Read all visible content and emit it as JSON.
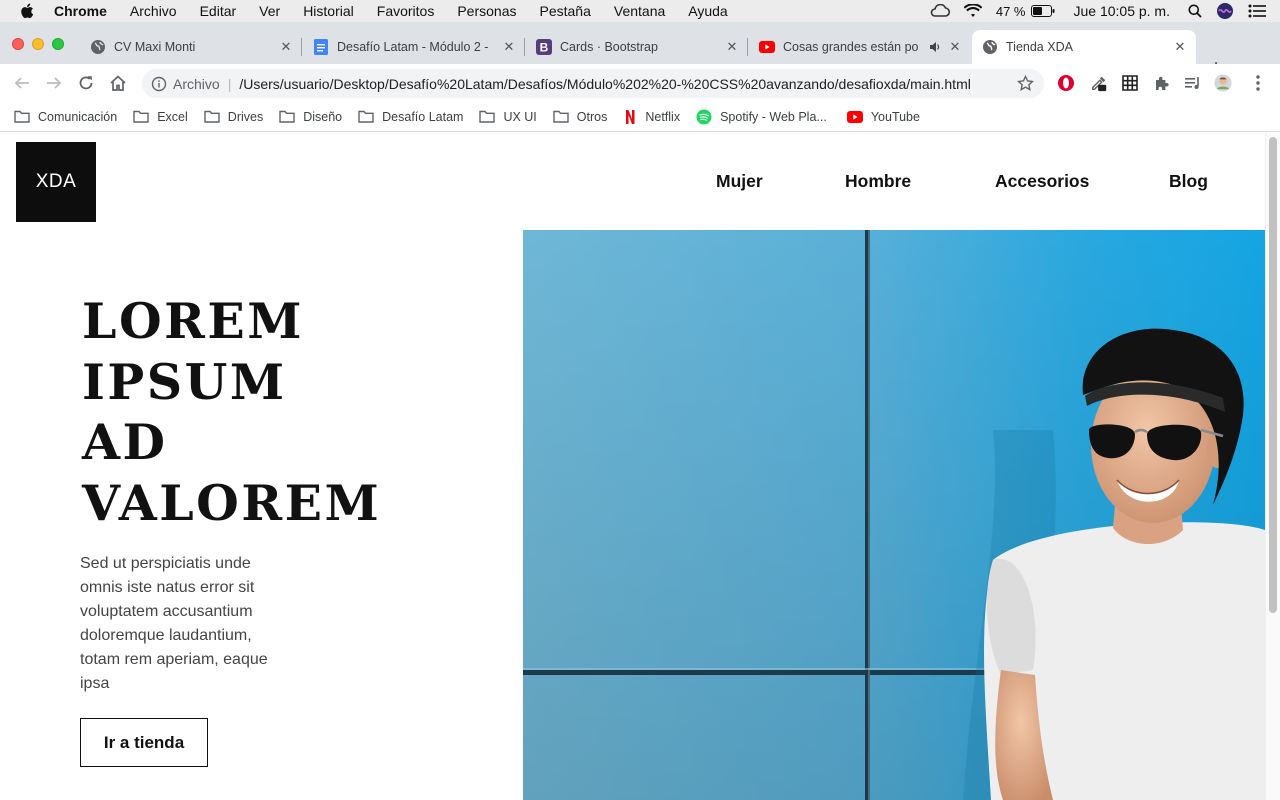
{
  "menubar": {
    "app": "Chrome",
    "items": [
      "Archivo",
      "Editar",
      "Ver",
      "Historial",
      "Favoritos",
      "Personas",
      "Pestaña",
      "Ventana",
      "Ayuda"
    ],
    "battery": "47 %",
    "clock": "Jue 10:05 p. m."
  },
  "tabs": [
    {
      "title": "CV Maxi Monti",
      "icon": "globe-icon"
    },
    {
      "title": "Desafío Latam - Módulo 2 -",
      "icon": "google-docs-icon"
    },
    {
      "title": "Cards · Bootstrap",
      "icon": "bootstrap-icon"
    },
    {
      "title": "Cosas grandes están po",
      "icon": "youtube-icon"
    },
    {
      "title": "Tienda XDA",
      "icon": "globe-icon",
      "active": true
    }
  ],
  "address": {
    "scheme": "Archivo",
    "url": "/Users/usuario/Desktop/Desafío%20Latam/Desafíos/Módulo%202%20-%20CSS%20avanzando/desafioxda/main.html"
  },
  "bookmarks": [
    {
      "label": "Comunicación",
      "icon": "folder-icon"
    },
    {
      "label": "Excel",
      "icon": "folder-icon"
    },
    {
      "label": "Drives",
      "icon": "folder-icon"
    },
    {
      "label": "Diseño",
      "icon": "folder-icon"
    },
    {
      "label": "Desafío Latam",
      "icon": "folder-icon"
    },
    {
      "label": "UX UI",
      "icon": "folder-icon"
    },
    {
      "label": "Otros",
      "icon": "folder-icon"
    },
    {
      "label": "Netflix",
      "icon": "netflix-icon"
    },
    {
      "label": "Spotify - Web Pla...",
      "icon": "spotify-icon"
    },
    {
      "label": "YouTube",
      "icon": "youtube-icon"
    }
  ],
  "site": {
    "logo": "XDA",
    "nav": [
      "Mujer",
      "Hombre",
      "Accesorios",
      "Blog"
    ],
    "hero": {
      "title_lines": [
        "LOREM",
        "IPSUM",
        "AD",
        "VALOREM"
      ],
      "text": "Sed ut perspiciatis unde omnis iste natus error sit voluptatem accusantium doloremque laudantium, totam rem aperiam, eaque ipsa",
      "cta": "Ir a tienda"
    }
  },
  "colors": {
    "accent_dark": "#0d0d0d",
    "hero_wall": "#5ab8dc",
    "tab_strip": "#dee1e6"
  }
}
